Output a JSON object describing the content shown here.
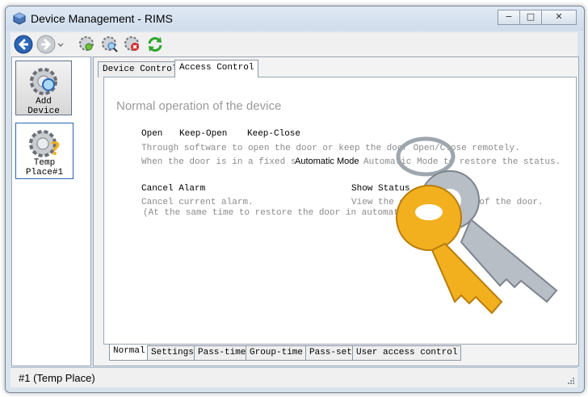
{
  "window": {
    "title": "Device Management - RIMS",
    "minimize_glyph": "−",
    "maximize_glyph": "□",
    "close_glyph": "✕"
  },
  "toolbar": {
    "icons": [
      "back-arrow-icon",
      "forward-arrow-icon",
      "device-search-icon",
      "device-view-icon",
      "device-delete-icon",
      "refresh-icon"
    ]
  },
  "devices": {
    "add_label_1": "Add",
    "add_label_2": "Device",
    "temp_label_1": "Temp",
    "temp_label_2": "Place#1"
  },
  "tabs": {
    "device_control": "Device Control",
    "access_control": "Access Control"
  },
  "content": {
    "heading": "Normal operation of the device",
    "open": "Open",
    "keep_open": "Keep-Open",
    "keep_close": "Keep-Close",
    "desc_line1": "Through software to open the door or keep the door Open/Close remotely.",
    "desc_line2_pre": "When the door is in a fixed sta",
    "auto_mode_btn": "Automatic Mode",
    "desc_line2_post": "Automatic Mode       to restore the status.",
    "cancel_alarm": "Cancel Alarm",
    "show_status": "Show Status",
    "cancel_desc1": "Cancel current alarm.",
    "cancel_desc2": "(At the same time to restore the door in automatic mode)",
    "status_desc": "View the current status of the door."
  },
  "bottom_tabs": [
    "Normal",
    "Settings",
    "Pass-time",
    "Group-time",
    "Pass-set",
    "User access control"
  ],
  "status": {
    "text": "#1 (Temp Place)"
  },
  "colors": {
    "key_gold": "#f2b01e",
    "key_silver": "#b7bec6",
    "arrow_blue": "#2a64b6",
    "refresh_green": "#2fa52f"
  }
}
